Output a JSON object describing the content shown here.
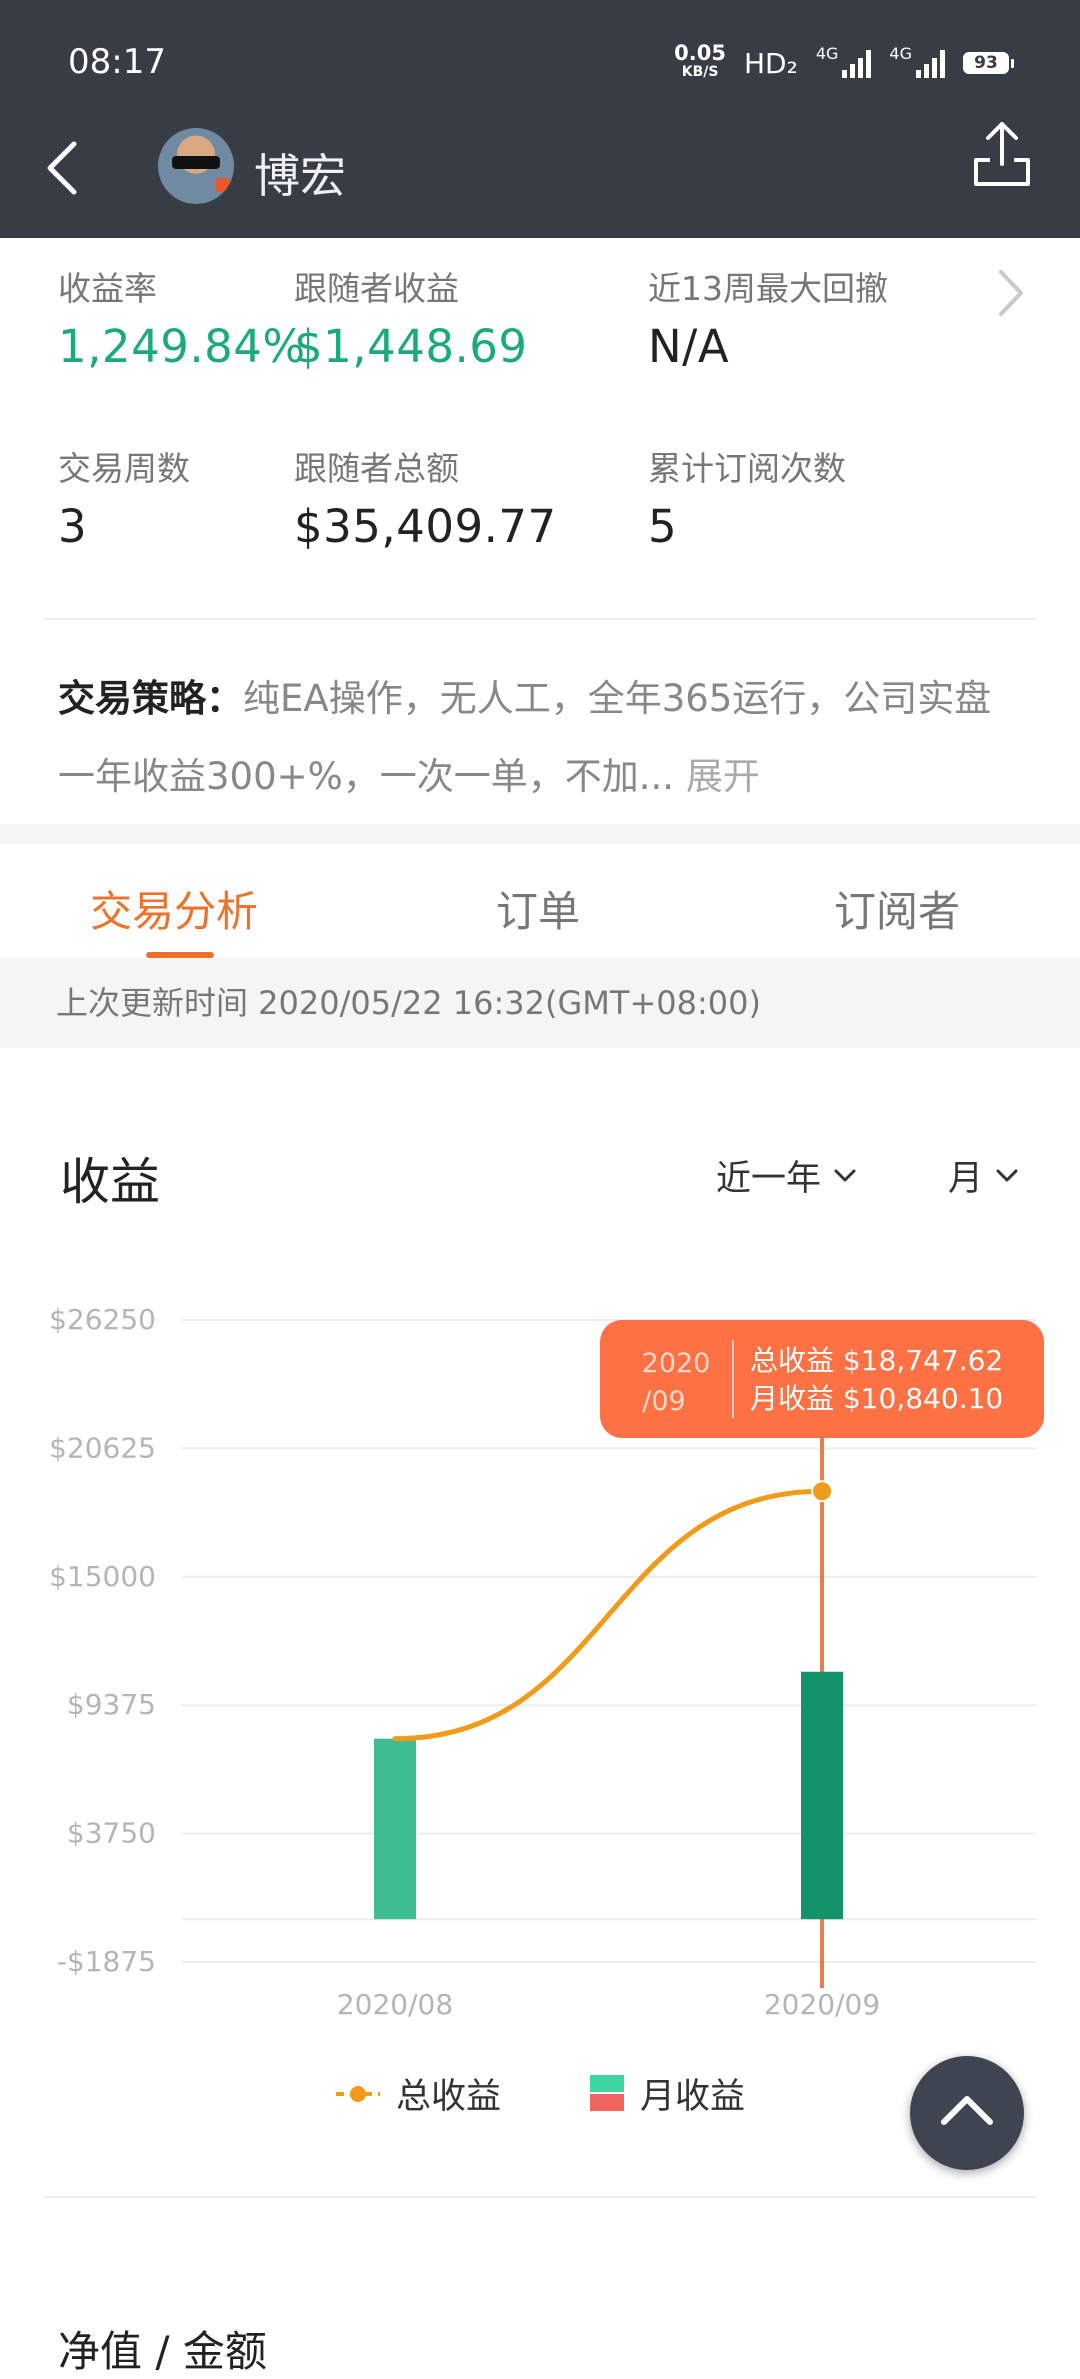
{
  "status_bar": {
    "time": "08:17",
    "net_speed": "0.05",
    "net_speed_unit": "KB/S",
    "hd": "HD₂",
    "net1": "4G",
    "net2": "4G",
    "battery": "93"
  },
  "header": {
    "name": "博宏"
  },
  "stats": {
    "return_rate_label": "收益率",
    "return_rate_value": "1,249.84%",
    "follower_profit_label": "跟随者收益",
    "follower_profit_value": "$1,448.69",
    "max_drawdown_label": "近13周最大回撤",
    "max_drawdown_value": "N/A",
    "trade_weeks_label": "交易周数",
    "trade_weeks_value": "3",
    "follower_total_label": "跟随者总额",
    "follower_total_value": "$35,409.77",
    "subscriptions_label": "累计订阅次数",
    "subscriptions_value": "5"
  },
  "strategy": {
    "label": "交易策略：",
    "text": "纯EA操作，无人工，全年365运行，公司实盘一年收益300+%，一次一单，不加...",
    "more": "展开"
  },
  "tabs": [
    "交易分析",
    "订单",
    "订阅者"
  ],
  "update_text": "上次更新时间 2020/05/22 16:32(GMT+08:00)",
  "section": {
    "title": "收益",
    "range_dropdown": "近一年",
    "period_dropdown": "月"
  },
  "colors": {
    "line": "#f29a1a",
    "bar_pos_light": "#3dbd91",
    "bar_pos_dark": "#14936b",
    "bar_neg": "#f0665e",
    "tooltip_bg": "#fd7144",
    "cursor": "#f07a50",
    "header_bg": "#373c45",
    "accent": "#f07229"
  },
  "chart_data": {
    "type": "bar+line",
    "categories": [
      "2020/08",
      "2020/09"
    ],
    "yticks": [
      "$26250",
      "$20625",
      "$15000",
      "$9375",
      "$3750",
      "-$1875"
    ],
    "ylim": [
      -1875,
      26250
    ],
    "series": [
      {
        "name": "总收益",
        "type": "line",
        "values": [
          7907.52,
          18747.62
        ]
      },
      {
        "name": "月收益",
        "type": "bar",
        "values": [
          7907.52,
          10840.1
        ]
      }
    ],
    "legend": [
      "总收益",
      "月收益"
    ],
    "legend_placement": "bottom",
    "tooltip": {
      "date_line1": "2020",
      "date_line2": "/09",
      "total_label": "总收益 $18,747.62",
      "month_label": "月收益 $10,840.10"
    },
    "highlight_index": 1
  },
  "bottom_section_title": "净值 / 金额"
}
